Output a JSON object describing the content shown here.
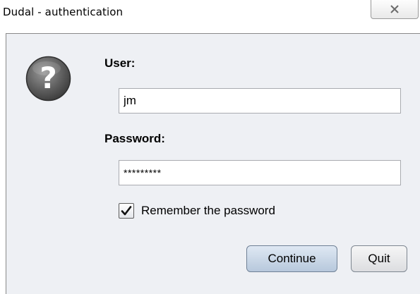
{
  "window": {
    "title": "Dudal - authentication"
  },
  "form": {
    "user_label": "User:",
    "user_value": "jm",
    "password_label": "Password:",
    "password_value": "*********",
    "remember_label": "Remember the password",
    "remember_checked": true
  },
  "buttons": {
    "continue_label": "Continue",
    "quit_label": "Quit"
  },
  "icons": {
    "dialog_icon": "question-icon",
    "close_icon": "close-icon",
    "check_icon": "checkmark-icon"
  },
  "colors": {
    "panel_bg": "#eef0f4",
    "continue_bg": "#c9d7e8"
  }
}
